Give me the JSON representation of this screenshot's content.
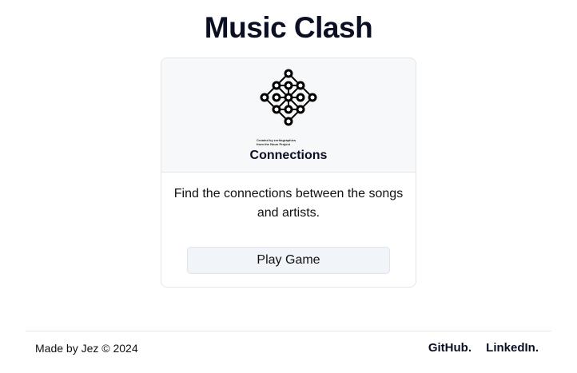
{
  "header": {
    "title": "Music Clash"
  },
  "card": {
    "icon": "network-diamond-icon",
    "icon_credit_line1": "Created by zeritographics",
    "icon_credit_line2": "from the Noun Project",
    "title": "Connections",
    "description": "Find the connections between the songs and artists.",
    "play_label": "Play Game"
  },
  "footer": {
    "made_by": "Made by Jez © 2024",
    "github_label": "GitHub.",
    "linkedin_label": "LinkedIn."
  }
}
